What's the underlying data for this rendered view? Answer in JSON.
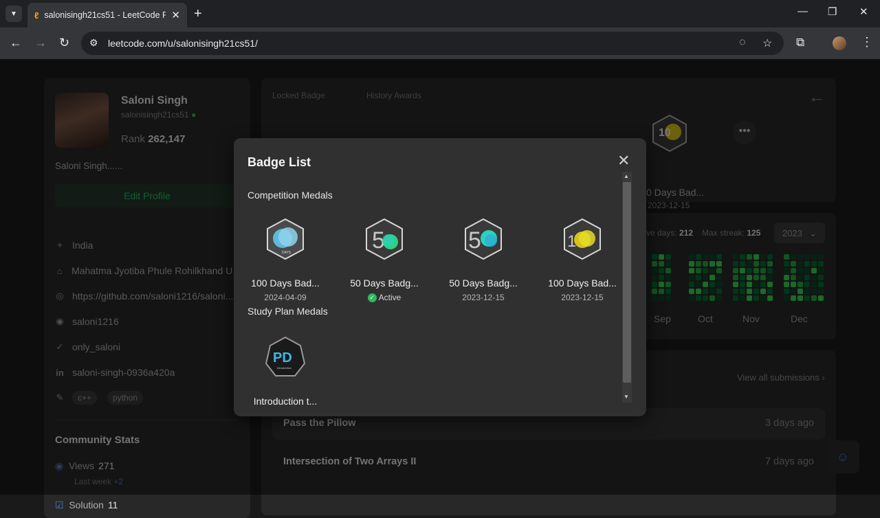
{
  "browser": {
    "tab_title": "salonisingh21cs51 - LeetCode P",
    "url": "leetcode.com/u/salonisingh21cs51/"
  },
  "profile": {
    "name": "Saloni Singh",
    "handle": "salonisingh21cs51",
    "rank_label": "Rank",
    "rank_value": "262,147",
    "bio": "Saloni Singh......",
    "edit_label": "Edit Profile",
    "location": "India",
    "school": "Mahatma Jyotiba Phule Rohilkhand U...",
    "website": "https://github.com/saloni1216/saloni...",
    "github": "saloni1216",
    "twitter": "only_saloni",
    "linkedin": "saloni-singh-0936a420a",
    "skills": [
      "c++",
      "python"
    ]
  },
  "community_stats": {
    "title": "Community Stats",
    "views_label": "Views",
    "views_value": "271",
    "last_week_label": "Last week",
    "last_week_delta": "+2",
    "solution_label": "Solution",
    "solution_value": "11"
  },
  "badges_card": {
    "locked_label": "Locked Badge",
    "history_label": "History Awards",
    "visible_name": "0 Days Bad...",
    "visible_date": "2023-12-15"
  },
  "calendar": {
    "active_days_label": "ve days:",
    "active_days_value": "212",
    "max_streak_label": "Max streak:",
    "max_streak_value": "125",
    "year": "2023",
    "months": [
      "Sep",
      "Oct",
      "Nov",
      "Dec"
    ]
  },
  "submissions": {
    "view_all": "View all submissions",
    "rows": [
      {
        "name": "Pass the Pillow",
        "time": "3 days ago"
      },
      {
        "name": "Intersection of Two Arrays II",
        "time": "7 days ago"
      }
    ]
  },
  "modal": {
    "title": "Badge List",
    "section_competition": "Competition Medals",
    "section_study": "Study Plan Medals",
    "competition": [
      {
        "name": "100 Days Bad...",
        "date": "2024-04-09",
        "icon": "100-days-badge-icon"
      },
      {
        "name": "50 Days Badg...",
        "status": "Active",
        "icon": "50-days-badge-icon"
      },
      {
        "name": "50 Days Badg...",
        "date": "2023-12-15",
        "icon": "50-days-badge-icon"
      },
      {
        "name": "100 Days Bad...",
        "date": "2023-12-15",
        "icon": "100-days-gold-badge-icon"
      }
    ],
    "study": [
      {
        "name": "Introduction t...",
        "icon": "pd-introduction-badge-icon"
      }
    ]
  },
  "colors": {
    "accent_green": "#2cbb5d",
    "bg": "#1a1a1a",
    "card": "#282828",
    "modal": "#303030"
  }
}
